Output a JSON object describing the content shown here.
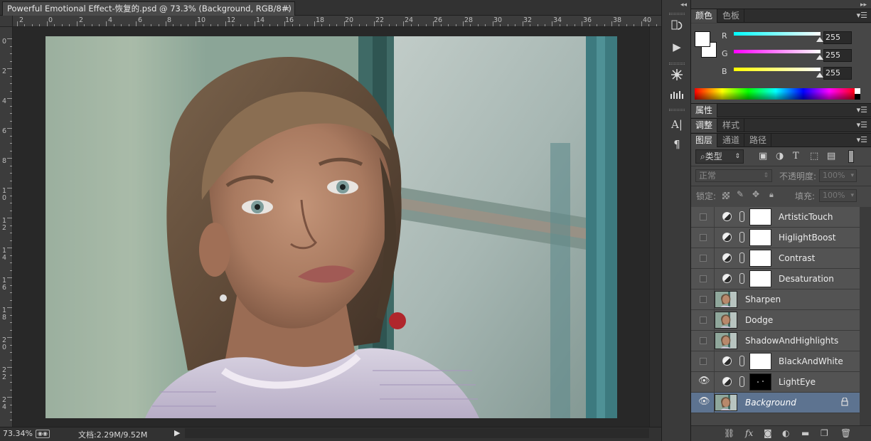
{
  "document": {
    "tab_title": "Powerful Emotional Effect-恢复的.psd @ 73.3% (Background, RGB/8#) *",
    "close_glyph": "×",
    "ruler_h_labels": [
      "2",
      "0",
      "2",
      "4",
      "6",
      "8",
      "10",
      "12",
      "14",
      "16",
      "18",
      "20",
      "22",
      "24",
      "26",
      "28",
      "30",
      "32",
      "34",
      "36",
      "38",
      "40"
    ],
    "ruler_v_labels": [
      "0",
      "2",
      "4",
      "6",
      "8",
      "1\n0",
      "1\n2",
      "1\n4",
      "1\n6",
      "1\n8",
      "2\n0",
      "2\n2",
      "2\n4"
    ]
  },
  "status": {
    "zoom": "73.34%",
    "doc_info": "文档:2.29M/9.52M"
  },
  "toolstrip": {
    "icons": [
      "history-icon",
      "play-action-icon",
      "brush-settings-icon",
      "brush-presets-icon",
      "character-icon",
      "paragraph-icon"
    ]
  },
  "color_panel": {
    "tabs": [
      "颜色",
      "色板"
    ],
    "active_tab": "颜色",
    "channels": [
      {
        "label": "R",
        "value": "255",
        "gradient_from": "#00ffff",
        "gradient_to": "#ffffff"
      },
      {
        "label": "G",
        "value": "255",
        "gradient_from": "#ff00ff",
        "gradient_to": "#ffffff"
      },
      {
        "label": "B",
        "value": "255",
        "gradient_from": "#ffff00",
        "gradient_to": "#ffffff"
      }
    ],
    "foreground": "#ffffff",
    "background": "#ffffff"
  },
  "properties_panel": {
    "tab": "属性"
  },
  "adjustments_panel": {
    "tabs": [
      "调整",
      "样式"
    ]
  },
  "layers_panel": {
    "tabs": [
      "图层",
      "通道",
      "路径"
    ],
    "filter_label": "类型",
    "blend_mode": "正常",
    "opacity_label": "不透明度:",
    "opacity_value": "100%",
    "lock_label": "锁定:",
    "fill_label": "填充:",
    "fill_value": "100%",
    "layers": [
      {
        "name": "ArtisticTouch",
        "kind": "adjustment",
        "visible": false,
        "mask": "white",
        "selected": false
      },
      {
        "name": "HiglightBoost",
        "kind": "adjustment",
        "visible": false,
        "mask": "white",
        "selected": false
      },
      {
        "name": "Contrast",
        "kind": "adjustment",
        "visible": false,
        "mask": "white",
        "selected": false
      },
      {
        "name": "Desaturation",
        "kind": "adjustment",
        "visible": false,
        "mask": "white",
        "selected": false
      },
      {
        "name": "Sharpen",
        "kind": "pixel",
        "visible": false,
        "selected": false
      },
      {
        "name": "Dodge",
        "kind": "pixel",
        "visible": false,
        "selected": false
      },
      {
        "name": "ShadowAndHighlights",
        "kind": "pixel",
        "visible": false,
        "selected": false
      },
      {
        "name": "BlackAndWhite",
        "kind": "adjustment",
        "visible": false,
        "mask": "white",
        "selected": false
      },
      {
        "name": "LightEye",
        "kind": "adjustment",
        "visible": true,
        "mask": "black",
        "selected": false
      },
      {
        "name": "Background",
        "kind": "pixel",
        "visible": true,
        "selected": true,
        "locked": true
      }
    ],
    "footer_icons": [
      "link-layers-icon",
      "fx-icon",
      "add-mask-icon",
      "adjustment-layer-icon",
      "group-folder-icon",
      "new-layer-icon",
      "trash-icon"
    ]
  }
}
